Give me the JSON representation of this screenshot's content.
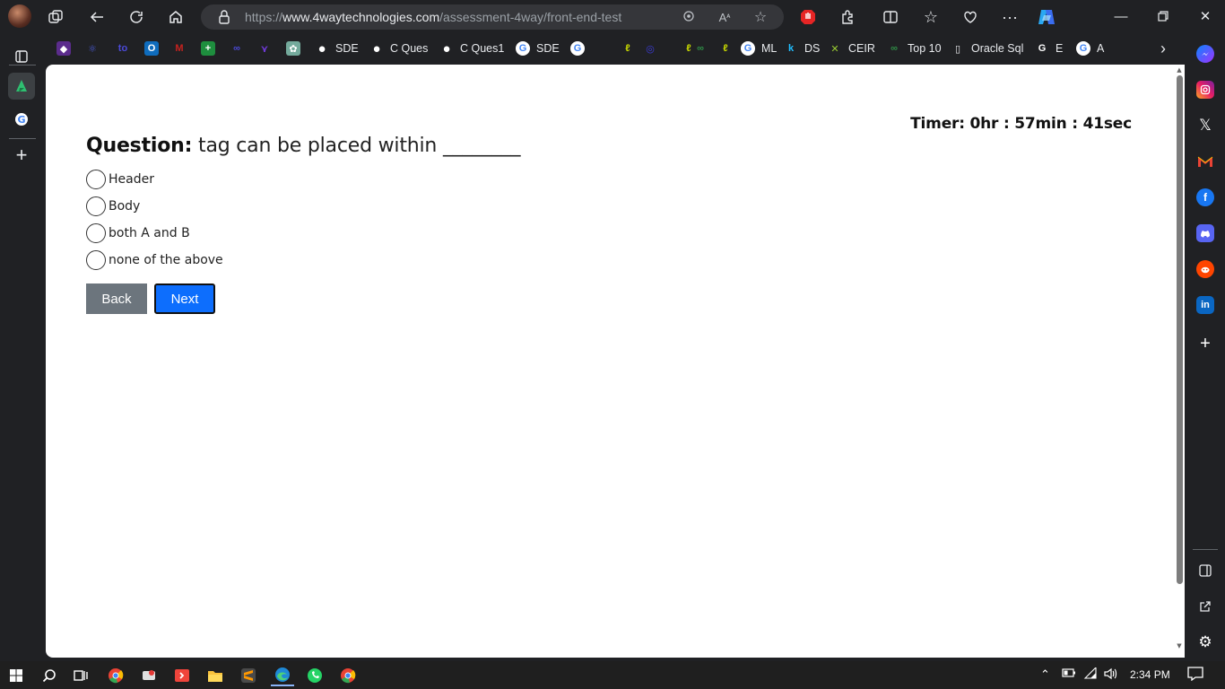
{
  "browser": {
    "url_prefix": "https://",
    "url_domain": "www.4waytechnologies.com",
    "url_path": "/assessment-4way/front-end-test"
  },
  "favorites": [
    {
      "label": "",
      "icon": "purple-app-icon",
      "color": "#6a3fb5"
    },
    {
      "label": "",
      "icon": "react-icon",
      "color": "#4a5bd6"
    },
    {
      "label": "",
      "icon": "to-icon",
      "color": "#4b4ad8"
    },
    {
      "label": "",
      "icon": "outlook-icon",
      "color": "#0f6cbd"
    },
    {
      "label": "",
      "icon": "gmail-icon",
      "color": "#c5221f"
    },
    {
      "label": "",
      "icon": "sheets-icon",
      "color": "#1e8e3e"
    },
    {
      "label": "",
      "icon": "link-icon",
      "color": "#4b4ad8"
    },
    {
      "label": "",
      "icon": "bird-icon",
      "color": "#6f3ad6"
    },
    {
      "label": "",
      "icon": "chatgpt-icon",
      "color": "#74aa9c"
    },
    {
      "label": "SDE",
      "icon": "github-icon",
      "color": "#ffffff"
    },
    {
      "label": "C Ques",
      "icon": "github-icon",
      "color": "#ffffff"
    },
    {
      "label": "C Ques1",
      "icon": "github-icon",
      "color": "#ffffff"
    },
    {
      "label": "SDE",
      "icon": "google-icon",
      "color": "#ffffff"
    },
    {
      "label": "",
      "icon": "google-icon",
      "color": "#ffffff"
    },
    {
      "label": "",
      "icon": "leetcode-icon",
      "color": "#c7d800"
    },
    {
      "label": "",
      "icon": "circle-icon",
      "color": "#3b3bd6"
    },
    {
      "label": "",
      "icon": "leetcode-icon",
      "color": "#c7d800"
    },
    {
      "label": "",
      "icon": "gfg-icon",
      "color": "#2f8d46"
    },
    {
      "label": "",
      "icon": "leetcode-icon",
      "color": "#c7d800"
    },
    {
      "label": "ML",
      "icon": "google-icon",
      "color": "#ffffff"
    },
    {
      "label": "DS",
      "icon": "k-icon",
      "color": "#20beff"
    },
    {
      "label": "CEIR",
      "icon": "x-leaf-icon",
      "color": "#9acd32"
    },
    {
      "label": "Top 10",
      "icon": "gfg-icon",
      "color": "#2f8d46"
    },
    {
      "label": "Oracle Sql",
      "icon": "page-icon",
      "color": "#e8eaed"
    },
    {
      "label": "E",
      "icon": "g-icon",
      "color": "#ffffff"
    },
    {
      "label": "A",
      "icon": "google-icon",
      "color": "#ffffff"
    }
  ],
  "page": {
    "timer": "Timer: 0hr : 57min : 41sec",
    "question_label": "Question:",
    "question_text": " tag can be placed within ________",
    "options": [
      "Header",
      "Body",
      "both A and B",
      "none of the above"
    ],
    "back_label": "Back",
    "next_label": "Next"
  },
  "taskbar": {
    "time": "2:34 PM"
  },
  "colors": {
    "next_button": "#0d6efd",
    "back_button": "#6c757d",
    "browser_chrome": "#202124"
  }
}
